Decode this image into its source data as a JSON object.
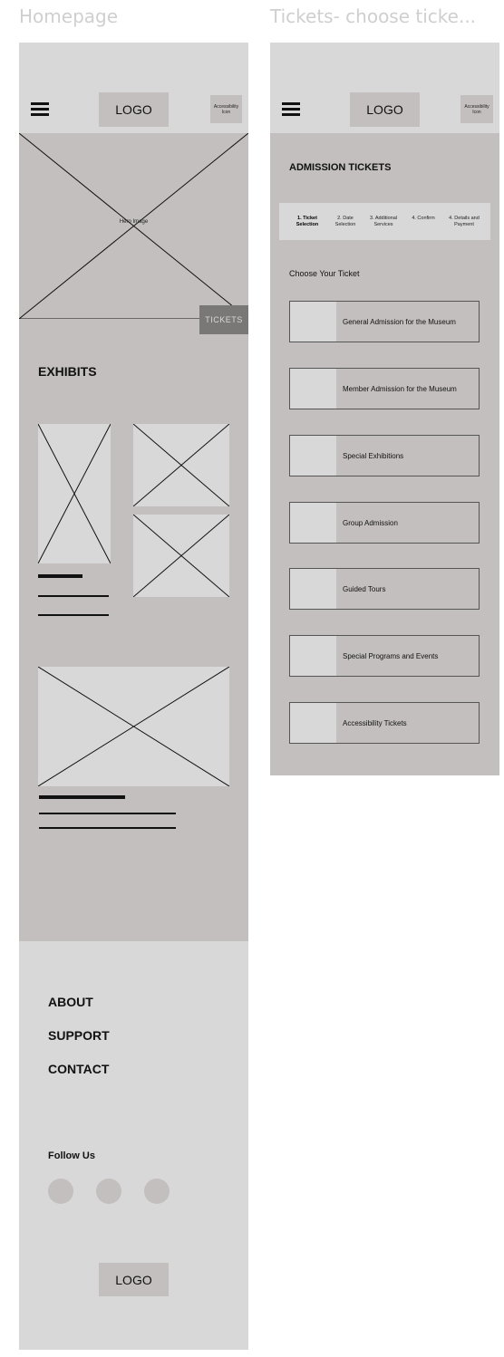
{
  "frames": {
    "homepage_label": "Homepage",
    "tickets_label": "Tickets- choose ticke..."
  },
  "homepage": {
    "header": {
      "logo": "LOGO",
      "accessibility_icon": "Accessibility Icon"
    },
    "hero": {
      "placeholder": "Hero Image",
      "tickets_button": "TICKETS"
    },
    "exhibits_heading": "EXHIBITS",
    "footer": {
      "links": [
        "ABOUT",
        "SUPPORT",
        "CONTACT"
      ],
      "follow_us": "Follow Us",
      "logo": "LOGO"
    }
  },
  "tickets": {
    "header": {
      "logo": "LOGO",
      "accessibility_icon": "Accessibility Icon"
    },
    "title": "ADMISSION TICKETS",
    "steps": [
      "1. Ticket Selection",
      "2. Date Selection",
      "3. Additional Services",
      "4. Confirm",
      "4. Details and Payment"
    ],
    "active_step": 0,
    "choose_label": "Choose Your Ticket",
    "options": [
      "General Admission for the Museum",
      "Member Admission for the Museum",
      "Special Exhibitions",
      "Group Admission",
      "Guided Tours",
      "Special Programs and Events",
      "Accessibility Tickets"
    ]
  },
  "colors": {
    "light_gray": "#d8d8d8",
    "mid_gray": "#c3bfbe",
    "dark_button": "#7a7877",
    "text": "#111111"
  }
}
